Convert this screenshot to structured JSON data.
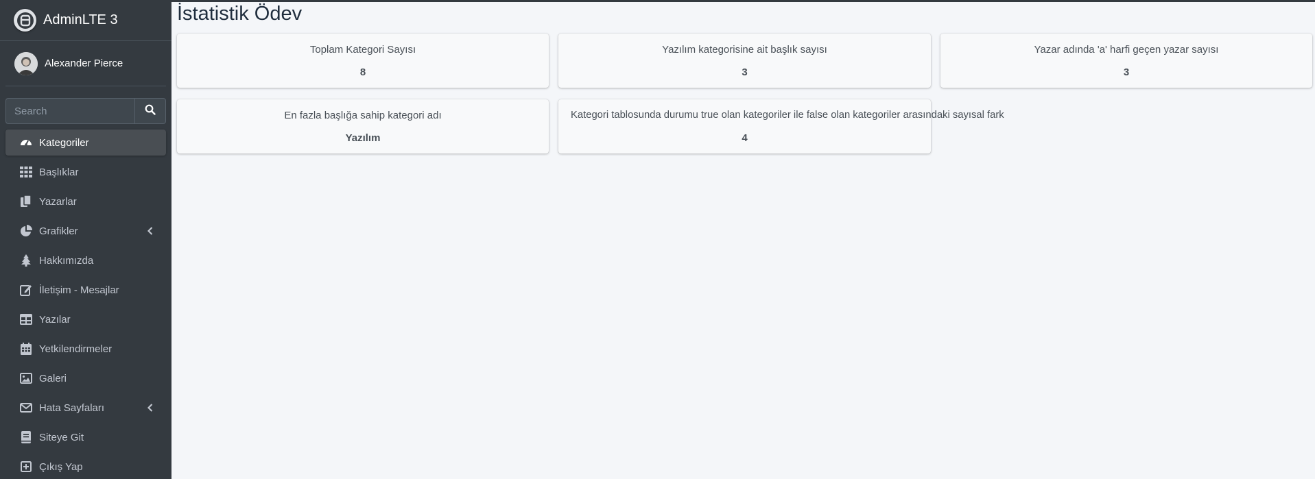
{
  "app": {
    "brand": "AdminLTE 3"
  },
  "user": {
    "name": "Alexander Pierce"
  },
  "search": {
    "placeholder": "Search"
  },
  "sidebar": {
    "items": [
      {
        "label": "Kategoriler",
        "icon": "tachometer-icon",
        "active": true
      },
      {
        "label": "Başlıklar",
        "icon": "grid-icon"
      },
      {
        "label": "Yazarlar",
        "icon": "copy-icon"
      },
      {
        "label": "Grafikler",
        "icon": "pie-chart-icon",
        "has_submenu": true
      },
      {
        "label": "Hakkımızda",
        "icon": "tree-icon"
      },
      {
        "label": "İletişim - Mesajlar",
        "icon": "edit-icon"
      },
      {
        "label": "Yazılar",
        "icon": "table-icon"
      },
      {
        "label": "Yetkilendirmeler",
        "icon": "calendar-icon"
      },
      {
        "label": "Galeri",
        "icon": "image-icon"
      },
      {
        "label": "Hata Sayfaları",
        "icon": "envelope-icon",
        "has_submenu": true
      },
      {
        "label": "Siteye Git",
        "icon": "book-icon"
      },
      {
        "label": "Çıkış Yap",
        "icon": "plus-square-icon"
      }
    ]
  },
  "page": {
    "title": "İstatistik Ödev"
  },
  "cards": [
    {
      "label": "Toplam Kategori Sayısı",
      "value": "8"
    },
    {
      "label": "Yazılım kategorisine ait başlık sayısı",
      "value": "3"
    },
    {
      "label": "Yazar adında 'a' harfi geçen yazar sayısı",
      "value": "3"
    },
    {
      "label": "En fazla başlığa sahip kategori adı",
      "value": "Yazılım"
    },
    {
      "label": "Kategori tablosunda durumu true olan kategoriler ile false olan kategoriler arasındaki sayısal fark",
      "value": "4"
    }
  ],
  "colors": {
    "sidebar_bg": "#343a40",
    "content_bg": "#f4f6f9",
    "active_item_bg": "#494e53",
    "card_bg": "#f8f9fa"
  }
}
